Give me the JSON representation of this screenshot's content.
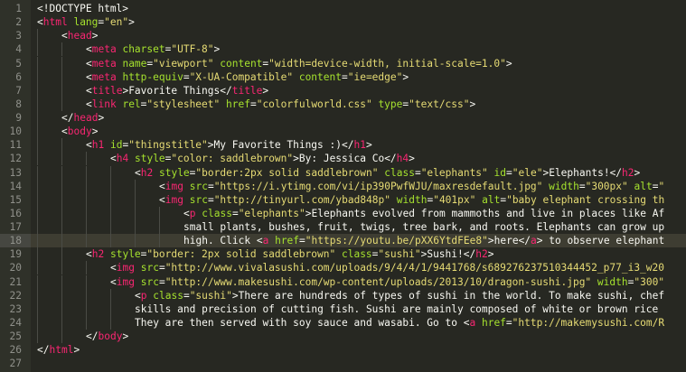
{
  "editor": {
    "theme": {
      "background": "#272822",
      "gutter_background": "#2f3129",
      "current_line_background": "#3e3d32",
      "line_number_color": "#8f908a",
      "text": "#f8f8f2",
      "tag": "#f92672",
      "attribute": "#a6e22e",
      "string": "#e6db74"
    },
    "current_line": 18,
    "lines": [
      {
        "number": "1",
        "indent": 0,
        "tokens": [
          [
            "doctype",
            "<!DOCTYPE html>"
          ]
        ]
      },
      {
        "number": "2",
        "indent": 0,
        "tokens": [
          [
            "punct",
            "<"
          ],
          [
            "tag",
            "html"
          ],
          [
            "sp",
            " "
          ],
          [
            "attr",
            "lang"
          ],
          [
            "punct",
            "="
          ],
          [
            "string",
            "\"en\""
          ],
          [
            "punct",
            ">"
          ]
        ]
      },
      {
        "number": "3",
        "indent": 1,
        "tokens": [
          [
            "punct",
            "<"
          ],
          [
            "tag",
            "head"
          ],
          [
            "punct",
            ">"
          ]
        ]
      },
      {
        "number": "4",
        "indent": 2,
        "tokens": [
          [
            "punct",
            "<"
          ],
          [
            "tag",
            "meta"
          ],
          [
            "sp",
            " "
          ],
          [
            "attr",
            "charset"
          ],
          [
            "punct",
            "="
          ],
          [
            "string",
            "\"UTF-8\""
          ],
          [
            "punct",
            ">"
          ]
        ]
      },
      {
        "number": "5",
        "indent": 2,
        "tokens": [
          [
            "punct",
            "<"
          ],
          [
            "tag",
            "meta"
          ],
          [
            "sp",
            " "
          ],
          [
            "attr",
            "name"
          ],
          [
            "punct",
            "="
          ],
          [
            "string",
            "\"viewport\""
          ],
          [
            "sp",
            " "
          ],
          [
            "attr",
            "content"
          ],
          [
            "punct",
            "="
          ],
          [
            "string",
            "\"width=device-width, initial-scale=1.0\""
          ],
          [
            "punct",
            ">"
          ]
        ]
      },
      {
        "number": "6",
        "indent": 2,
        "tokens": [
          [
            "punct",
            "<"
          ],
          [
            "tag",
            "meta"
          ],
          [
            "sp",
            " "
          ],
          [
            "attr",
            "http-equiv"
          ],
          [
            "punct",
            "="
          ],
          [
            "string",
            "\"X-UA-Compatible\""
          ],
          [
            "sp",
            " "
          ],
          [
            "attr",
            "content"
          ],
          [
            "punct",
            "="
          ],
          [
            "string",
            "\"ie=edge\""
          ],
          [
            "punct",
            ">"
          ]
        ]
      },
      {
        "number": "7",
        "indent": 2,
        "tokens": [
          [
            "punct",
            "<"
          ],
          [
            "tag",
            "title"
          ],
          [
            "punct",
            ">"
          ],
          [
            "plain",
            "Favorite Things"
          ],
          [
            "punct",
            "</"
          ],
          [
            "tag",
            "title"
          ],
          [
            "punct",
            ">"
          ]
        ]
      },
      {
        "number": "8",
        "indent": 2,
        "tokens": [
          [
            "punct",
            "<"
          ],
          [
            "tag",
            "link"
          ],
          [
            "sp",
            " "
          ],
          [
            "attr",
            "rel"
          ],
          [
            "punct",
            "="
          ],
          [
            "string",
            "\"stylesheet\""
          ],
          [
            "sp",
            " "
          ],
          [
            "attr",
            "href"
          ],
          [
            "punct",
            "="
          ],
          [
            "string",
            "\"colorfulworld.css\""
          ],
          [
            "sp",
            " "
          ],
          [
            "attr",
            "type"
          ],
          [
            "punct",
            "="
          ],
          [
            "string",
            "\"text/css\""
          ],
          [
            "punct",
            ">"
          ]
        ]
      },
      {
        "number": "9",
        "indent": 1,
        "tokens": [
          [
            "punct",
            "</"
          ],
          [
            "tag",
            "head"
          ],
          [
            "punct",
            ">"
          ]
        ]
      },
      {
        "number": "10",
        "indent": 1,
        "tokens": [
          [
            "punct",
            "<"
          ],
          [
            "tag",
            "body"
          ],
          [
            "punct",
            ">"
          ]
        ]
      },
      {
        "number": "11",
        "indent": 2,
        "tokens": [
          [
            "punct",
            "<"
          ],
          [
            "tag",
            "h1"
          ],
          [
            "sp",
            " "
          ],
          [
            "attr",
            "id"
          ],
          [
            "punct",
            "="
          ],
          [
            "string",
            "\"thingstitle\""
          ],
          [
            "punct",
            ">"
          ],
          [
            "plain",
            "My Favorite Things :)"
          ],
          [
            "punct",
            "</"
          ],
          [
            "tag",
            "h1"
          ],
          [
            "punct",
            ">"
          ]
        ]
      },
      {
        "number": "12",
        "indent": 3,
        "tokens": [
          [
            "punct",
            "<"
          ],
          [
            "tag",
            "h4"
          ],
          [
            "sp",
            " "
          ],
          [
            "attr",
            "style"
          ],
          [
            "punct",
            "="
          ],
          [
            "string",
            "\"color: saddlebrown\""
          ],
          [
            "punct",
            ">"
          ],
          [
            "plain",
            "By: Jessica Co"
          ],
          [
            "punct",
            "</"
          ],
          [
            "tag",
            "h4"
          ],
          [
            "punct",
            ">"
          ]
        ]
      },
      {
        "number": "13",
        "indent": 4,
        "tokens": [
          [
            "punct",
            "<"
          ],
          [
            "tag",
            "h2"
          ],
          [
            "sp",
            " "
          ],
          [
            "attr",
            "style"
          ],
          [
            "punct",
            "="
          ],
          [
            "string",
            "\"border:2px solid saddlebrown\""
          ],
          [
            "sp",
            " "
          ],
          [
            "attr",
            "class"
          ],
          [
            "punct",
            "="
          ],
          [
            "string",
            "\"elephants\""
          ],
          [
            "sp",
            " "
          ],
          [
            "attr",
            "id"
          ],
          [
            "punct",
            "="
          ],
          [
            "string",
            "\"ele\""
          ],
          [
            "punct",
            ">"
          ],
          [
            "plain",
            "Elephants!"
          ],
          [
            "punct",
            "</"
          ],
          [
            "tag",
            "h2"
          ],
          [
            "punct",
            ">"
          ]
        ]
      },
      {
        "number": "14",
        "indent": 5,
        "tokens": [
          [
            "punct",
            "<"
          ],
          [
            "tag",
            "img"
          ],
          [
            "sp",
            " "
          ],
          [
            "attr",
            "src"
          ],
          [
            "punct",
            "="
          ],
          [
            "string",
            "\"https://i.ytimg.com/vi/ip390PwfWJU/maxresdefault.jpg\""
          ],
          [
            "sp",
            " "
          ],
          [
            "attr",
            "width"
          ],
          [
            "punct",
            "="
          ],
          [
            "string",
            "\"300px\""
          ],
          [
            "sp",
            " "
          ],
          [
            "attr",
            "alt"
          ],
          [
            "punct",
            "="
          ],
          [
            "string",
            "\""
          ]
        ]
      },
      {
        "number": "15",
        "indent": 5,
        "tokens": [
          [
            "punct",
            "<"
          ],
          [
            "tag",
            "img"
          ],
          [
            "sp",
            " "
          ],
          [
            "attr",
            "src"
          ],
          [
            "punct",
            "="
          ],
          [
            "string",
            "\"http://tinyurl.com/ybad848p\""
          ],
          [
            "sp",
            " "
          ],
          [
            "attr",
            "width"
          ],
          [
            "punct",
            "="
          ],
          [
            "string",
            "\"401px\""
          ],
          [
            "sp",
            " "
          ],
          [
            "attr",
            "alt"
          ],
          [
            "punct",
            "="
          ],
          [
            "string",
            "\"baby elephant crossing th"
          ]
        ]
      },
      {
        "number": "16",
        "indent": 6,
        "tokens": [
          [
            "punct",
            "<"
          ],
          [
            "tag",
            "p"
          ],
          [
            "sp",
            " "
          ],
          [
            "attr",
            "class"
          ],
          [
            "punct",
            "="
          ],
          [
            "string",
            "\"elephants\""
          ],
          [
            "punct",
            ">"
          ],
          [
            "plain",
            "Elephants evolved from mammoths and live in places like Af"
          ]
        ]
      },
      {
        "number": "17",
        "indent": 6,
        "tokens": [
          [
            "plain",
            "small plants, bushes, fruit, twigs, tree bark, and roots. Elephants can grow up"
          ]
        ]
      },
      {
        "number": "18",
        "indent": 6,
        "tokens": [
          [
            "plain",
            "high. Click "
          ],
          [
            "punct",
            "<"
          ],
          [
            "tag",
            "a"
          ],
          [
            "sp",
            " "
          ],
          [
            "attr",
            "href"
          ],
          [
            "punct",
            "="
          ],
          [
            "string",
            "\"https://youtu.be/pXX6YtdFEe8\""
          ],
          [
            "punct",
            ">"
          ],
          [
            "plain",
            "here"
          ],
          [
            "punct",
            "</"
          ],
          [
            "tag",
            "a"
          ],
          [
            "punct",
            ">"
          ],
          [
            "plain",
            " to observe elephant"
          ]
        ]
      },
      {
        "number": "19",
        "indent": 2,
        "tokens": [
          [
            "punct",
            "<"
          ],
          [
            "tag",
            "h2"
          ],
          [
            "sp",
            " "
          ],
          [
            "attr",
            "style"
          ],
          [
            "punct",
            "="
          ],
          [
            "string",
            "\"border: 2px solid saddlebrown\""
          ],
          [
            "sp",
            " "
          ],
          [
            "attr",
            "class"
          ],
          [
            "punct",
            "="
          ],
          [
            "string",
            "\"sushi\""
          ],
          [
            "punct",
            ">"
          ],
          [
            "plain",
            "Sushi!"
          ],
          [
            "punct",
            "</"
          ],
          [
            "tag",
            "h2"
          ],
          [
            "punct",
            ">"
          ]
        ]
      },
      {
        "number": "20",
        "indent": 3,
        "tokens": [
          [
            "punct",
            "<"
          ],
          [
            "tag",
            "img"
          ],
          [
            "sp",
            " "
          ],
          [
            "attr",
            "src"
          ],
          [
            "punct",
            "="
          ],
          [
            "string",
            "\"http://www.vivalasushi.com/uploads/9/4/4/1/9441768/s689276237510344452_p77_i3_w20"
          ]
        ]
      },
      {
        "number": "21",
        "indent": 3,
        "tokens": [
          [
            "punct",
            "<"
          ],
          [
            "tag",
            "img"
          ],
          [
            "sp",
            " "
          ],
          [
            "attr",
            "src"
          ],
          [
            "punct",
            "="
          ],
          [
            "string",
            "\"http://www.makesushi.com/wp-content/uploads/2013/10/dragon-sushi.jpg\""
          ],
          [
            "sp",
            " "
          ],
          [
            "attr",
            "width"
          ],
          [
            "punct",
            "="
          ],
          [
            "string",
            "\"300\""
          ]
        ]
      },
      {
        "number": "22",
        "indent": 4,
        "tokens": [
          [
            "punct",
            "<"
          ],
          [
            "tag",
            "p"
          ],
          [
            "sp",
            " "
          ],
          [
            "attr",
            "class"
          ],
          [
            "punct",
            "="
          ],
          [
            "string",
            "\"sushi\""
          ],
          [
            "punct",
            ">"
          ],
          [
            "plain",
            "There are hundreds of types of sushi in the world. To make sushi, chef"
          ]
        ]
      },
      {
        "number": "23",
        "indent": 4,
        "tokens": [
          [
            "plain",
            "skills and precision of cutting fish. Sushi are mainly composed of white or brown rice"
          ]
        ]
      },
      {
        "number": "24",
        "indent": 4,
        "tokens": [
          [
            "plain",
            "They are then served with soy sauce and wasabi. Go to "
          ],
          [
            "punct",
            "<"
          ],
          [
            "tag",
            "a"
          ],
          [
            "sp",
            " "
          ],
          [
            "attr",
            "href"
          ],
          [
            "punct",
            "="
          ],
          [
            "string",
            "\"http://makemysushi.com/R"
          ]
        ]
      },
      {
        "number": "25",
        "indent": 2,
        "tokens": [
          [
            "punct",
            "</"
          ],
          [
            "tag",
            "body"
          ],
          [
            "punct",
            ">"
          ]
        ]
      },
      {
        "number": "26",
        "indent": 0,
        "tokens": [
          [
            "punct",
            "</"
          ],
          [
            "tag",
            "html"
          ],
          [
            "punct",
            ">"
          ]
        ]
      },
      {
        "number": "27",
        "indent": 0,
        "tokens": []
      }
    ]
  }
}
